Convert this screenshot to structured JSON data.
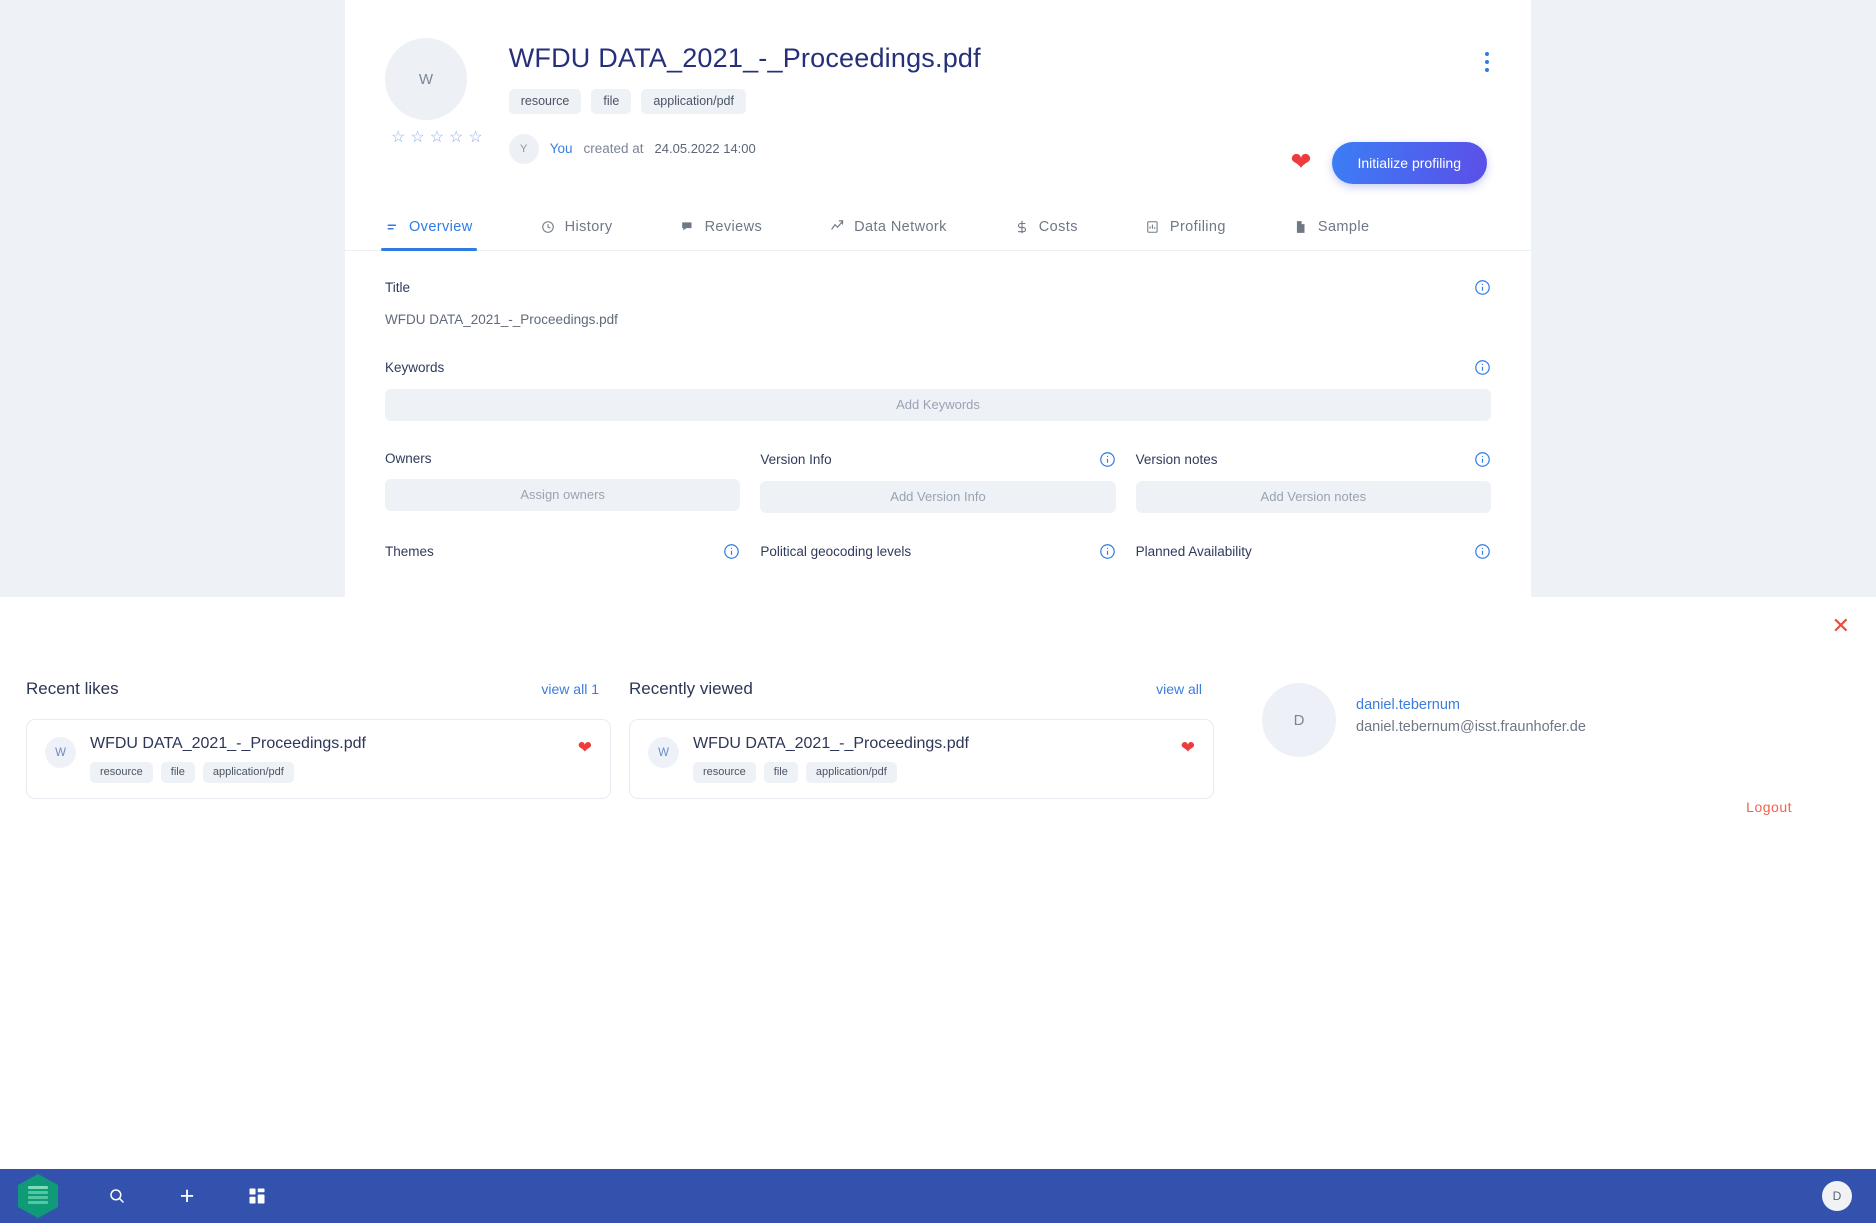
{
  "detail": {
    "avatar_initial": "W",
    "title": "WFDU DATA_2021_-_Proceedings.pdf",
    "chips": [
      "resource",
      "file",
      "application/pdf"
    ],
    "creator": {
      "initial": "Y",
      "name": "You",
      "created_label": "created at",
      "created_value": "24.05.2022 14:00"
    },
    "rating_stars": 5,
    "like_icon": "heart-icon",
    "primary_button": "Initialize profiling",
    "menu_icon": "kebab-menu-icon"
  },
  "tabs": [
    {
      "label": "Overview",
      "icon": "list-icon",
      "active": true
    },
    {
      "label": "History",
      "icon": "clock-icon",
      "active": false
    },
    {
      "label": "Reviews",
      "icon": "comment-icon",
      "active": false
    },
    {
      "label": "Data Network",
      "icon": "trend-icon",
      "active": false
    },
    {
      "label": "Costs",
      "icon": "dollar-icon",
      "active": false
    },
    {
      "label": "Profiling",
      "icon": "chart-box-icon",
      "active": false
    },
    {
      "label": "Sample",
      "icon": "document-icon",
      "active": false
    }
  ],
  "form": {
    "title_label": "Title",
    "title_value": "WFDU DATA_2021_-_Proceedings.pdf",
    "keywords_label": "Keywords",
    "keywords_placeholder": "Add Keywords",
    "owners_label": "Owners",
    "owners_placeholder": "Assign owners",
    "version_info_label": "Version Info",
    "version_info_placeholder": "Add Version Info",
    "version_notes_label": "Version notes",
    "version_notes_placeholder": "Add Version notes",
    "themes_label": "Themes",
    "geocoding_label": "Political geocoding levels",
    "availability_label": "Planned Availability"
  },
  "overlay": {
    "close_icon": "close-icon",
    "recent_likes": {
      "title": "Recent likes",
      "view_all": "view all 1",
      "items": [
        {
          "avatar_initial": "W",
          "name": "WFDU DATA_2021_-_Proceedings.pdf",
          "chips": [
            "resource",
            "file",
            "application/pdf"
          ],
          "liked": true
        }
      ]
    },
    "recently_viewed": {
      "title": "Recently viewed",
      "view_all": "view all",
      "items": [
        {
          "avatar_initial": "W",
          "name": "WFDU DATA_2021_-_Proceedings.pdf",
          "chips": [
            "resource",
            "file",
            "application/pdf"
          ],
          "liked": true
        }
      ]
    },
    "profile": {
      "avatar_initial": "D",
      "username": "daniel.tebernum",
      "email": "daniel.tebernum@isst.fraunhofer.de",
      "logout": "Logout"
    }
  },
  "bottom_nav": {
    "logo": "app-logo-icon",
    "buttons": [
      {
        "icon": "search-icon"
      },
      {
        "icon": "plus-icon"
      },
      {
        "icon": "dashboard-icon"
      }
    ],
    "avatar_initial": "D"
  },
  "colors": {
    "accent_blue": "#2f7be4",
    "nav_blue": "#3352ad",
    "heart_red": "#ee3b3b",
    "logout_red": "#f0634f",
    "logo_green": "#0f9b77",
    "panel_grey": "#eef1f6"
  }
}
